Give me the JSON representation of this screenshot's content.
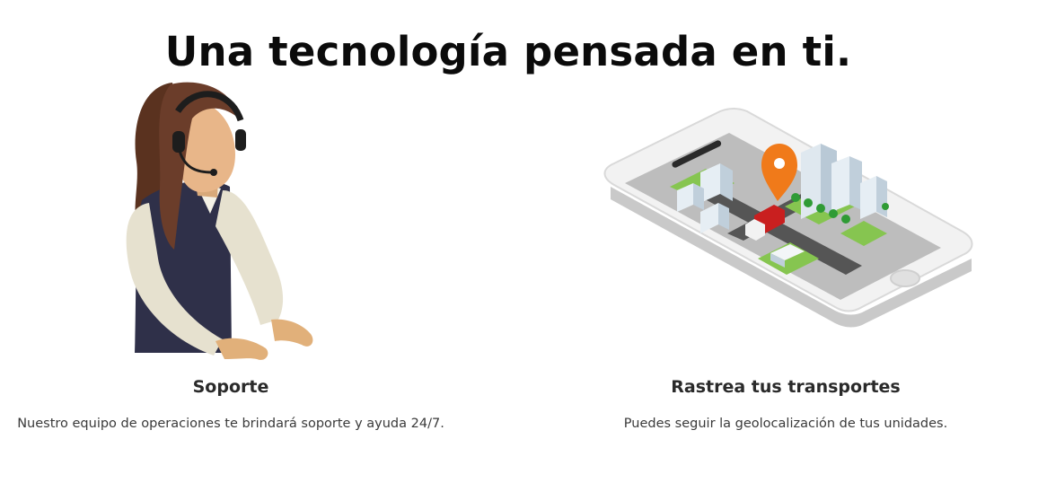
{
  "section": {
    "title": "Una tecnología pensada en ti."
  },
  "cards": [
    {
      "heading": "Soporte",
      "text": "Nuestro equipo de operaciones te brindará soporte y ayuda 24/7.",
      "illustration": "support-agent-illustration"
    },
    {
      "heading": "Rastrea tus transportes",
      "text": "Puedes seguir la geolocalización de tus unidades.",
      "illustration": "phone-tracking-illustration"
    }
  ],
  "colors": {
    "pin": "#f07a1a",
    "truck": "#c91f1f",
    "grass": "#86c550",
    "vest": "#2f3049",
    "hair": "#6b3d2a"
  }
}
